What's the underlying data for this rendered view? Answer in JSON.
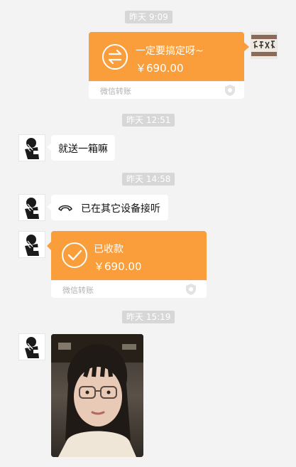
{
  "timestamps": [
    "昨天 9:09",
    "昨天 12:51",
    "昨天 14:58",
    "昨天 15:19"
  ],
  "msg_transfer_sent": {
    "title": "一定要搞定呀~",
    "amount": "￥690.00",
    "label": "微信转账"
  },
  "msg_text": {
    "text": "就送一箱嘛"
  },
  "msg_call": {
    "text": "已在其它设备接听"
  },
  "msg_transfer_received": {
    "title": "已收款",
    "amount": "￥690.00",
    "label": "微信转账"
  },
  "colors": {
    "transfer_orange": "#fa9d3b",
    "background": "#f3f3f3",
    "time_chip": "#d7d7d7"
  },
  "icons": [
    "transfer-arrows-icon",
    "shield-icon",
    "phone-hangup-icon",
    "check-circle-icon"
  ]
}
